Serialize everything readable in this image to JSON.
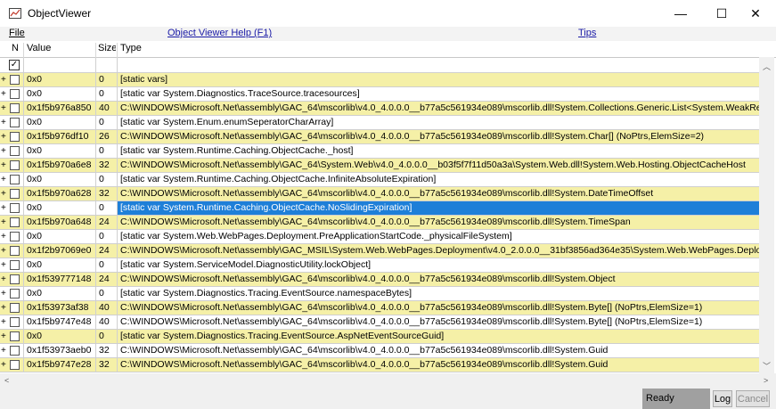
{
  "window": {
    "title": "ObjectViewer",
    "minimize": "—",
    "maximize": "☐",
    "close": "✕"
  },
  "menu": {
    "file": "File",
    "help_link": "Object Viewer Help (F1)",
    "tips_link": "Tips"
  },
  "columns": {
    "n": "N",
    "value": "Value",
    "size": "Size",
    "type": "Type"
  },
  "filter_row": {
    "checked": true
  },
  "rows": [
    {
      "value": "0x0",
      "size": "0",
      "type": "[static vars]",
      "style": "y"
    },
    {
      "value": "0x0",
      "size": "0",
      "type": "[static var System.Diagnostics.TraceSource.tracesources]",
      "style": "w"
    },
    {
      "value": "0x1f5b976a850",
      "size": "40",
      "type": "C:\\WINDOWS\\Microsoft.Net\\assembly\\GAC_64\\mscorlib\\v4.0_4.0.0.0__b77a5c561934e089\\mscorlib.dll!System.Collections.Generic.List<System.WeakReference>",
      "style": "y"
    },
    {
      "value": "0x0",
      "size": "0",
      "type": "[static var System.Enum.enumSeperatorCharArray]",
      "style": "w"
    },
    {
      "value": "0x1f5b976df10",
      "size": "26",
      "type": "C:\\WINDOWS\\Microsoft.Net\\assembly\\GAC_64\\mscorlib\\v4.0_4.0.0.0__b77a5c561934e089\\mscorlib.dll!System.Char[] (NoPtrs,ElemSize=2)",
      "style": "y"
    },
    {
      "value": "0x0",
      "size": "0",
      "type": "[static var System.Runtime.Caching.ObjectCache._host]",
      "style": "w"
    },
    {
      "value": "0x1f5b970a6e8",
      "size": "32",
      "type": "C:\\WINDOWS\\Microsoft.Net\\assembly\\GAC_64\\System.Web\\v4.0_4.0.0.0__b03f5f7f11d50a3a\\System.Web.dll!System.Web.Hosting.ObjectCacheHost",
      "style": "y"
    },
    {
      "value": "0x0",
      "size": "0",
      "type": "[static var System.Runtime.Caching.ObjectCache.InfiniteAbsoluteExpiration]",
      "style": "w"
    },
    {
      "value": "0x1f5b970a628",
      "size": "32",
      "type": "C:\\WINDOWS\\Microsoft.Net\\assembly\\GAC_64\\mscorlib\\v4.0_4.0.0.0__b77a5c561934e089\\mscorlib.dll!System.DateTimeOffset",
      "style": "y"
    },
    {
      "value": "0x0",
      "size": "0",
      "type": "[static var System.Runtime.Caching.ObjectCache.NoSlidingExpiration]",
      "style": "w",
      "selected": true
    },
    {
      "value": "0x1f5b970a648",
      "size": "24",
      "type": "C:\\WINDOWS\\Microsoft.Net\\assembly\\GAC_64\\mscorlib\\v4.0_4.0.0.0__b77a5c561934e089\\mscorlib.dll!System.TimeSpan",
      "style": "y"
    },
    {
      "value": "0x0",
      "size": "0",
      "type": "[static var System.Web.WebPages.Deployment.PreApplicationStartCode._physicalFileSystem]",
      "style": "w"
    },
    {
      "value": "0x1f2b97069e0",
      "size": "24",
      "type": "C:\\WINDOWS\\Microsoft.Net\\assembly\\GAC_MSIL\\System.Web.WebPages.Deployment\\v4.0_2.0.0.0__31bf3856ad364e35\\System.Web.WebPages.Deployment.dll!M",
      "style": "y"
    },
    {
      "value": "0x0",
      "size": "0",
      "type": "[static var System.ServiceModel.DiagnosticUtility.lockObject]",
      "style": "w"
    },
    {
      "value": "0x1f539777148",
      "size": "24",
      "type": "C:\\WINDOWS\\Microsoft.Net\\assembly\\GAC_64\\mscorlib\\v4.0_4.0.0.0__b77a5c561934e089\\mscorlib.dll!System.Object",
      "style": "y"
    },
    {
      "value": "0x0",
      "size": "0",
      "type": "[static var System.Diagnostics.Tracing.EventSource.namespaceBytes]",
      "style": "w"
    },
    {
      "value": "0x1f53973af38",
      "size": "40",
      "type": "C:\\WINDOWS\\Microsoft.Net\\assembly\\GAC_64\\mscorlib\\v4.0_4.0.0.0__b77a5c561934e089\\mscorlib.dll!System.Byte[] (NoPtrs,ElemSize=1)",
      "style": "y"
    },
    {
      "value": "0x1f5b9747e48",
      "size": "40",
      "type": "C:\\WINDOWS\\Microsoft.Net\\assembly\\GAC_64\\mscorlib\\v4.0_4.0.0.0__b77a5c561934e089\\mscorlib.dll!System.Byte[] (NoPtrs,ElemSize=1)",
      "style": "w"
    },
    {
      "value": "0x0",
      "size": "0",
      "type": "[static var System.Diagnostics.Tracing.EventSource.AspNetEventSourceGuid]",
      "style": "y"
    },
    {
      "value": "0x1f53973aeb0",
      "size": "32",
      "type": "C:\\WINDOWS\\Microsoft.Net\\assembly\\GAC_64\\mscorlib\\v4.0_4.0.0.0__b77a5c561934e089\\mscorlib.dll!System.Guid",
      "style": "w"
    },
    {
      "value": "0x1f5b9747e28",
      "size": "32",
      "type": "C:\\WINDOWS\\Microsoft.Net\\assembly\\GAC_64\\mscorlib\\v4.0_4.0.0.0__b77a5c561934e089\\mscorlib.dll!System.Guid",
      "style": "y"
    }
  ],
  "status": {
    "text": "Ready",
    "log_button": "Log",
    "cancel_button": "Cancel"
  },
  "colors": {
    "row_yellow": "#f5f0a7",
    "selection": "#1e7fd8",
    "link": "#1a1aa6"
  }
}
